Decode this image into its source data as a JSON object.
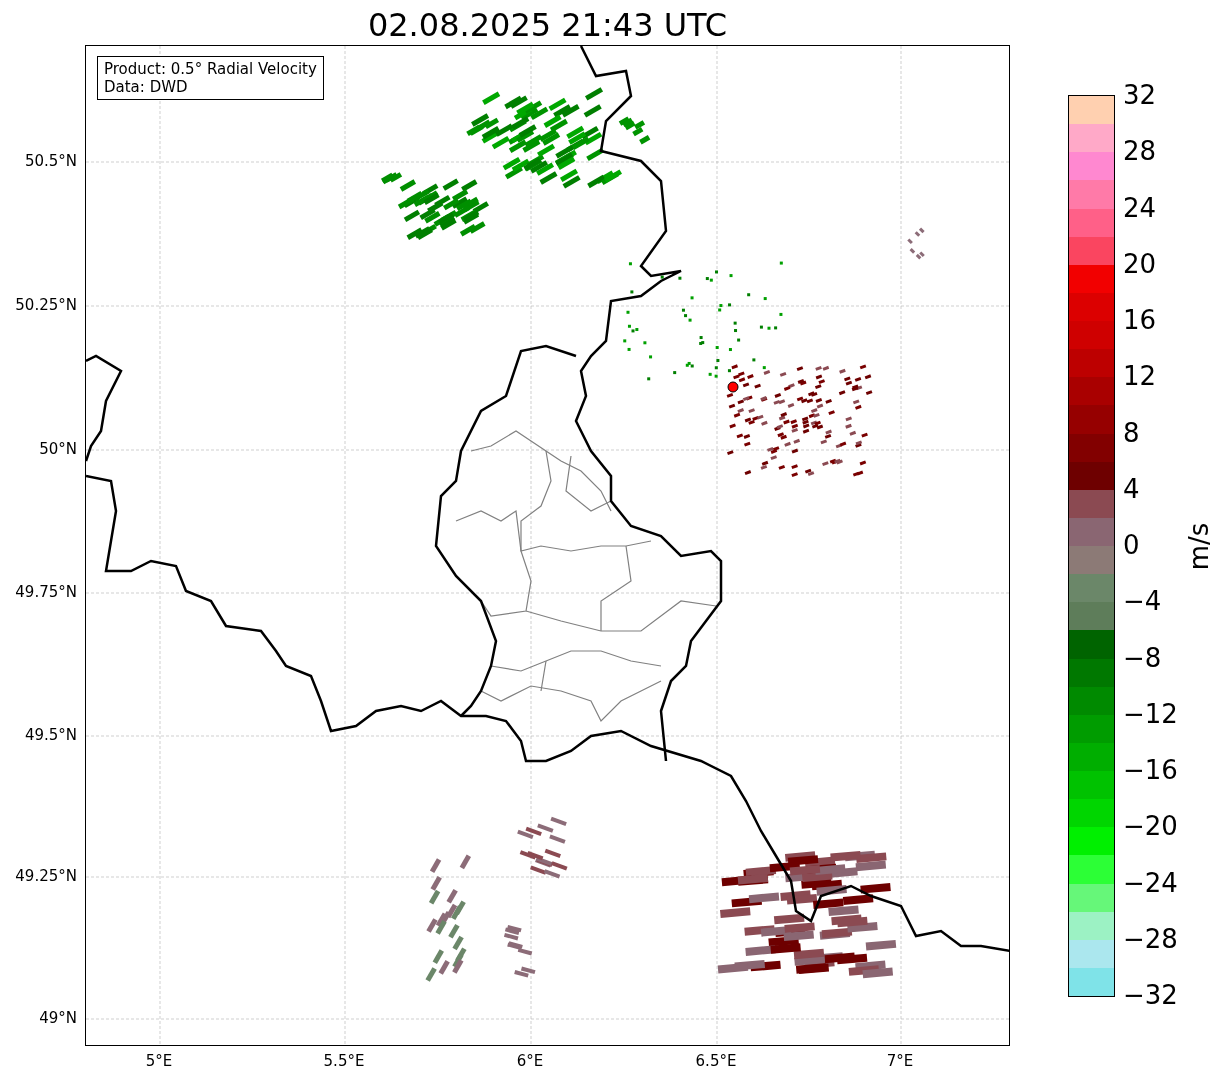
{
  "title": "02.08.2025 21:43 UTC",
  "legend": [
    "Product: 0.5° Radial Velocity",
    "Data: DWD"
  ],
  "lat_ticks": [
    "50.5°N",
    "50.25°N",
    "50°N",
    "49.75°N",
    "49.5°N",
    "49.25°N",
    "49°N"
  ],
  "lon_ticks": [
    "5°E",
    "5.5°E",
    "6°E",
    "6.5°E",
    "7°E"
  ],
  "colorbar": {
    "label": "m/s",
    "ticks": [
      "32",
      "28",
      "24",
      "20",
      "16",
      "12",
      "8",
      "4",
      "0",
      "−4",
      "−8",
      "−12",
      "−16",
      "−20",
      "−24",
      "−28",
      "−32"
    ],
    "segments": [
      {
        "color": "#ffd0b0"
      },
      {
        "color": "#ffa9c8"
      },
      {
        "color": "#ff88d0"
      },
      {
        "color": "#ff7aa8"
      },
      {
        "color": "#ff6088"
      },
      {
        "color": "#fa4560"
      },
      {
        "color": "#f20000"
      },
      {
        "color": "#dc0000"
      },
      {
        "color": "#cf0000"
      },
      {
        "color": "#bd0000"
      },
      {
        "color": "#a90000"
      },
      {
        "color": "#960000"
      },
      {
        "color": "#820000"
      },
      {
        "color": "#6e0000"
      },
      {
        "color": "#8b4a52"
      },
      {
        "color": "#8a6672"
      },
      {
        "color": "#8c7a76"
      },
      {
        "color": "#6b8769"
      },
      {
        "color": "#5e7d5a"
      },
      {
        "color": "#006400"
      },
      {
        "color": "#007800"
      },
      {
        "color": "#008a00"
      },
      {
        "color": "#009c00"
      },
      {
        "color": "#00ae00"
      },
      {
        "color": "#00c200"
      },
      {
        "color": "#00d600"
      },
      {
        "color": "#00f000"
      },
      {
        "color": "#2cff36"
      },
      {
        "color": "#66f779"
      },
      {
        "color": "#9cf2c4"
      },
      {
        "color": "#abe7ee"
      },
      {
        "color": "#7fe3e8"
      }
    ]
  }
}
